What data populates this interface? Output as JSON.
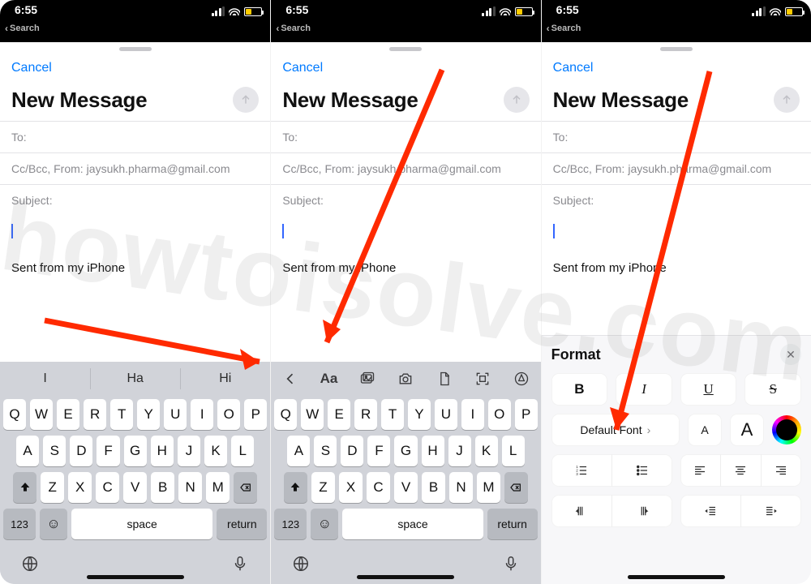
{
  "status": {
    "time": "6:55",
    "search_label": "Search"
  },
  "compose": {
    "cancel": "Cancel",
    "title": "New Message",
    "to_label": "To:",
    "ccbcc_label": "Cc/Bcc, From:",
    "from_email": "jaysukh.pharma@gmail.com",
    "subject_label": "Subject:",
    "signature": "Sent from my iPhone"
  },
  "suggestions": [
    "I",
    "Ha",
    "Hi"
  ],
  "keyboard": {
    "row1": [
      "Q",
      "W",
      "E",
      "R",
      "T",
      "Y",
      "U",
      "I",
      "O",
      "P"
    ],
    "row2": [
      "A",
      "S",
      "D",
      "F",
      "G",
      "H",
      "J",
      "K",
      "L"
    ],
    "row3": [
      "Z",
      "X",
      "C",
      "V",
      "B",
      "N",
      "M"
    ],
    "numkey": "123",
    "space": "space",
    "returnkey": "return"
  },
  "toolbar_icons": [
    "chevron-left",
    "text-format",
    "photo",
    "camera",
    "document",
    "scan",
    "markup"
  ],
  "format": {
    "title": "Format",
    "bold": "B",
    "italic": "I",
    "underline": "U",
    "strike": "S",
    "default_font": "Default Font",
    "smallA": "A",
    "largeA": "A"
  },
  "watermark": "howtoisolve.com"
}
